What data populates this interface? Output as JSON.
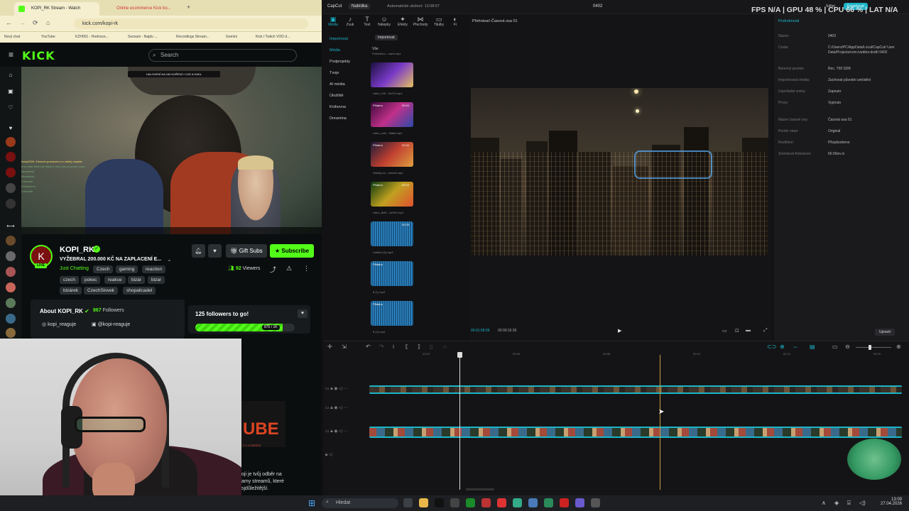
{
  "browser": {
    "tabs": [
      {
        "label": "KOPI_RK Stream - Watch"
      },
      {
        "label": "Online ecommerce Kick bo..."
      }
    ],
    "url": "kick.com/kopi-rk",
    "bookmarks": [
      "Nový chat",
      "YouTube",
      "KZH001 - Hodnoce...",
      "Seznam - Najdu ...",
      "Recordings Stream...",
      "Gemini",
      "Kick / Twitch VOD d..."
    ]
  },
  "kick": {
    "logo": "KICK",
    "search_placeholder": "Search",
    "video_banner": "HALOVENÍ NA 160 KOŘENÍ / LIVE A HADL",
    "chat_lines": [
      "lucky2003: Zdravím pravaceni a s velkej respekt.",
      "a ty máte ještě tak hlásit a něco tak po power case",
      "Nezatékej",
      "Nezatékej",
      "Lukrsudk",
      "Pořoprenor",
      "Lukrsudk"
    ],
    "channel_name": "KOPI_RK",
    "live_badge": "LIVE",
    "stream_title": "VYŽEBRAL 200.000 KČ NA ZAPLACENÍ E...",
    "category": "Just Chatting",
    "tags": [
      "Czech",
      "gaming",
      "reaction",
      "czech",
      "pokec",
      "reakce",
      "bizár",
      "bizar",
      "bizárek",
      "CzechSlovek",
      "shopalicadel"
    ],
    "gift_label": "Gift Subs",
    "subscribe_label": "Subscribe",
    "viewers_count": "92",
    "viewers_label": "Viewers",
    "about_title": "About KOPI_RK",
    "followers_count": "867",
    "followers_label": "Followers",
    "social_instagram": "kopi_reaguje",
    "social_x": "@kopi-reaguje",
    "goal_title": "125 followers to go!",
    "goal_progress": "875 / 1K",
    "goal_fraction": 0.875
  },
  "webcam": {
    "banner_text": "UBE",
    "banner_sub": "E V DOBRÉM",
    "overlay_lines": [
      "oji je tvůj odběr na",
      "amy streamů, které",
      "sjdůležitější."
    ]
  },
  "capcut": {
    "app_name": "CapCut",
    "menu": "Nabídka",
    "autosave": "Automatické uložení: 13:08:57",
    "project_title": "0402",
    "share": "Sdílet",
    "export": "Exportovat",
    "tools": [
      {
        "label": "Média",
        "icon": "media-icon"
      },
      {
        "label": "Zvuk",
        "icon": "audio-icon"
      },
      {
        "label": "Text",
        "icon": "text-icon"
      },
      {
        "label": "Nálepky",
        "icon": "sticker-icon"
      },
      {
        "label": "Efekty",
        "icon": "effects-icon"
      },
      {
        "label": "Přechody",
        "icon": "transitions-icon"
      },
      {
        "label": "Titulky",
        "icon": "captions-icon"
      },
      {
        "label": "Fi",
        "icon": "filters-icon"
      }
    ],
    "sidebar": [
      "Importovat",
      "Média",
      "Podprojekty",
      "Tvoje",
      "AI média",
      "Úložiště",
      "Knihovna",
      "Dreamina"
    ],
    "media_tabs": {
      "import": "Importovat",
      "all": "Vše",
      "sort": "Pohádka-u...mark.mp4"
    },
    "media_items": [
      {
        "name": "video_016...9c219.mp4",
        "dur": "",
        "added": ""
      },
      {
        "name": "video_cefc...f5ab8.mp4",
        "dur": "00:04",
        "added": "Přidáno"
      },
      {
        "name": "Stickky-co...emeek.mp4",
        "dur": "00:34",
        "added": "Přidáno"
      },
      {
        "name": "video_f695...1a992.mp4",
        "dur": "00:04",
        "added": "Přidáno"
      },
      {
        "name": "Untitled (3).mp3",
        "dur": "00:33",
        "added": ""
      },
      {
        "name": "ff (1).mp3",
        "dur": "",
        "added": "Přidáno"
      },
      {
        "name": "ff (2).mp3",
        "dur": "",
        "added": "Přidáno"
      }
    ],
    "player_title": "Přehrávač-Časová osa 01",
    "time_current": "00:01:58:09",
    "time_total": "00:09:16:35",
    "props_title": "Podrobnosti",
    "props": [
      {
        "k": "Název:",
        "v": "0402"
      },
      {
        "k": "Cesta:",
        "v": "C:/Users/PC/AppData/Local/CapCut/ User Data/Projects/com.lveditor.draft/ 0402"
      },
      {
        "k": "Barevný prostor:",
        "v": "Rec. 709 SDR"
      },
      {
        "k": "Importovaná média:",
        "v": "Zachovat původní umístění"
      },
      {
        "k": "Uspořádat vrstvy:",
        "v": "Zapnuto"
      },
      {
        "k": "Proxy:",
        "v": "Vypnuto"
      },
      {
        "k": "Název časové osy:",
        "v": "Časová osa 01"
      },
      {
        "k": "Poměr stran:",
        "v": "Originál"
      },
      {
        "k": "Rozlišení:",
        "v": "Přizpůsobeno"
      },
      {
        "k": "Snímková frekvence:",
        "v": "60.00sn./s"
      }
    ],
    "modify": "Upravit",
    "ruler": [
      "00:03",
      "00:05",
      "00:08",
      "00:10",
      "00:13",
      "00:15"
    ]
  },
  "stats": {
    "text": "FPS N/A | GPU 48 % | CPU 66 % | LAT N/A"
  },
  "taskbar": {
    "search": "Hledat",
    "time": "13:09",
    "date": "27.04.2026"
  }
}
